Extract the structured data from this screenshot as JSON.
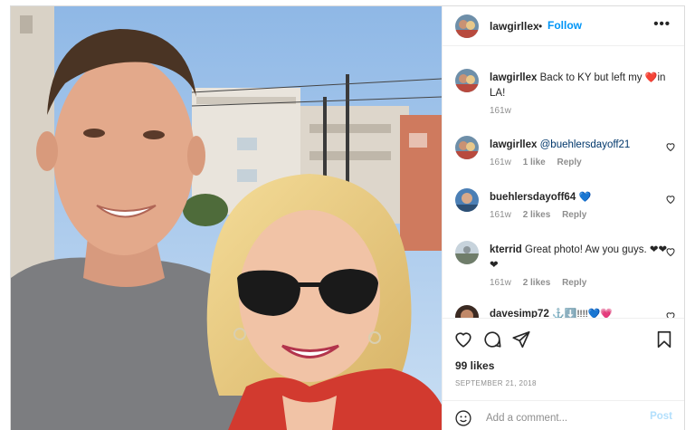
{
  "post": {
    "username": "lawgirllex",
    "separator": "•",
    "follow_label": "Follow",
    "more_label": "•••",
    "likes": "99 likes",
    "date": "SEPTEMBER 21, 2018",
    "add_comment_placeholder": "Add a comment...",
    "post_label": "Post"
  },
  "caption": {
    "username": "lawgirllex",
    "text_before": "Back to KY but left my ",
    "emoji": "❤️",
    "text_after": "in LA!",
    "time": "161w"
  },
  "comments": [
    {
      "username": "lawgirllex",
      "text": "@buehlersdayoff21",
      "time": "161w",
      "likes": "1 like",
      "reply": "Reply",
      "avatar_icon": "profile-photo-icon"
    },
    {
      "username": "buehlersdayoff64",
      "text": "💙",
      "time": "161w",
      "likes": "2 likes",
      "reply": "Reply",
      "avatar_icon": "profile-photo-icon"
    },
    {
      "username": "kterrid",
      "text": "Great photo! Aw you guys. ❤❤❤",
      "time": "161w",
      "likes": "2 likes",
      "reply": "Reply",
      "avatar_icon": "profile-photo-icon"
    },
    {
      "username": "davesimp72",
      "text": "⚓⬇️!!!!💙💗",
      "time": "",
      "likes": "",
      "reply": "",
      "avatar_icon": "profile-photo-icon"
    }
  ],
  "icons": {
    "like": "heart-icon",
    "comment": "comment-bubble-icon",
    "share": "paper-plane-icon",
    "save": "bookmark-icon",
    "emoji": "smiley-icon"
  },
  "colors": {
    "follow": "#0095f6",
    "post_disabled": "#b2dffc",
    "meta_gray": "#8e8e8e",
    "mention": "#00376b"
  }
}
